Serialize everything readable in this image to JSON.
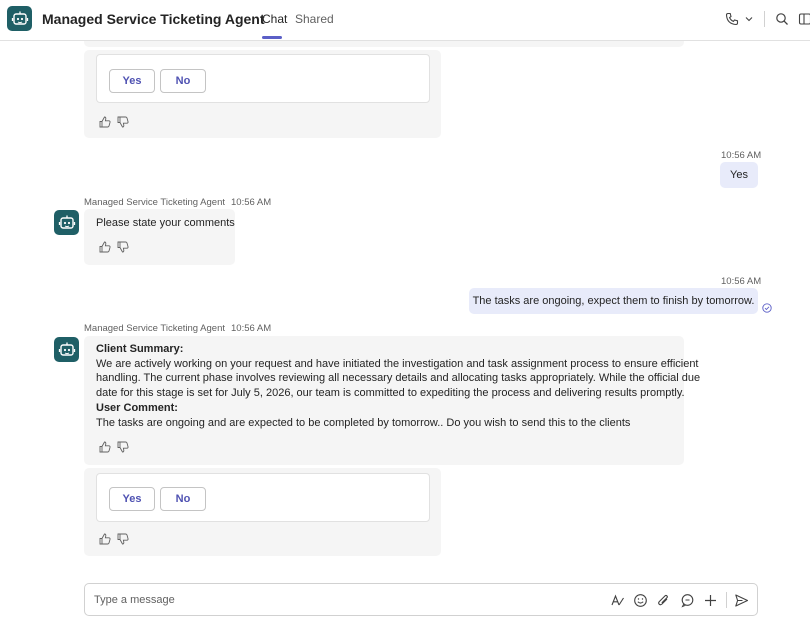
{
  "header": {
    "title": "Managed Service Ticketing Agent",
    "tabs": [
      {
        "label": "Chat",
        "active": true
      },
      {
        "label": "Shared",
        "active": false
      }
    ]
  },
  "messages": {
    "card1": {
      "yes_label": "Yes",
      "no_label": "No"
    },
    "user1": {
      "time": "10:56 AM",
      "text": "Yes"
    },
    "bot2": {
      "sender": "Managed Service Ticketing Agent",
      "time": "10:56 AM",
      "text": "Please state your comments"
    },
    "user2": {
      "time": "10:56 AM",
      "text": "The tasks are ongoing, expect them to finish by tomorrow."
    },
    "bot3": {
      "sender": "Managed Service Ticketing Agent",
      "time": "10:56 AM",
      "summary_heading": "Client Summary:",
      "summary_lines": [
        "We are actively working on your request and have initiated the investigation and task assignment process to ensure efficient",
        "handling. The current phase involves reviewing all necessary details and allocating tasks appropriately. While the official due",
        "date for this stage is set for July 5, 2026, our team is committed to expediting the process and delivering results promptly."
      ],
      "comment_heading": "User Comment:",
      "comment_text": "The tasks are ongoing and are expected to be completed by tomorrow.. Do you wish to send this to the clients"
    },
    "card2": {
      "yes_label": "Yes",
      "no_label": "No"
    }
  },
  "compose": {
    "placeholder": "Type a message"
  },
  "colors": {
    "accent": "#5b5fc7",
    "bot_avatar": "#1f5f66",
    "user_bubble": "#e8ebfa",
    "bot_bubble": "#f5f5f5"
  }
}
